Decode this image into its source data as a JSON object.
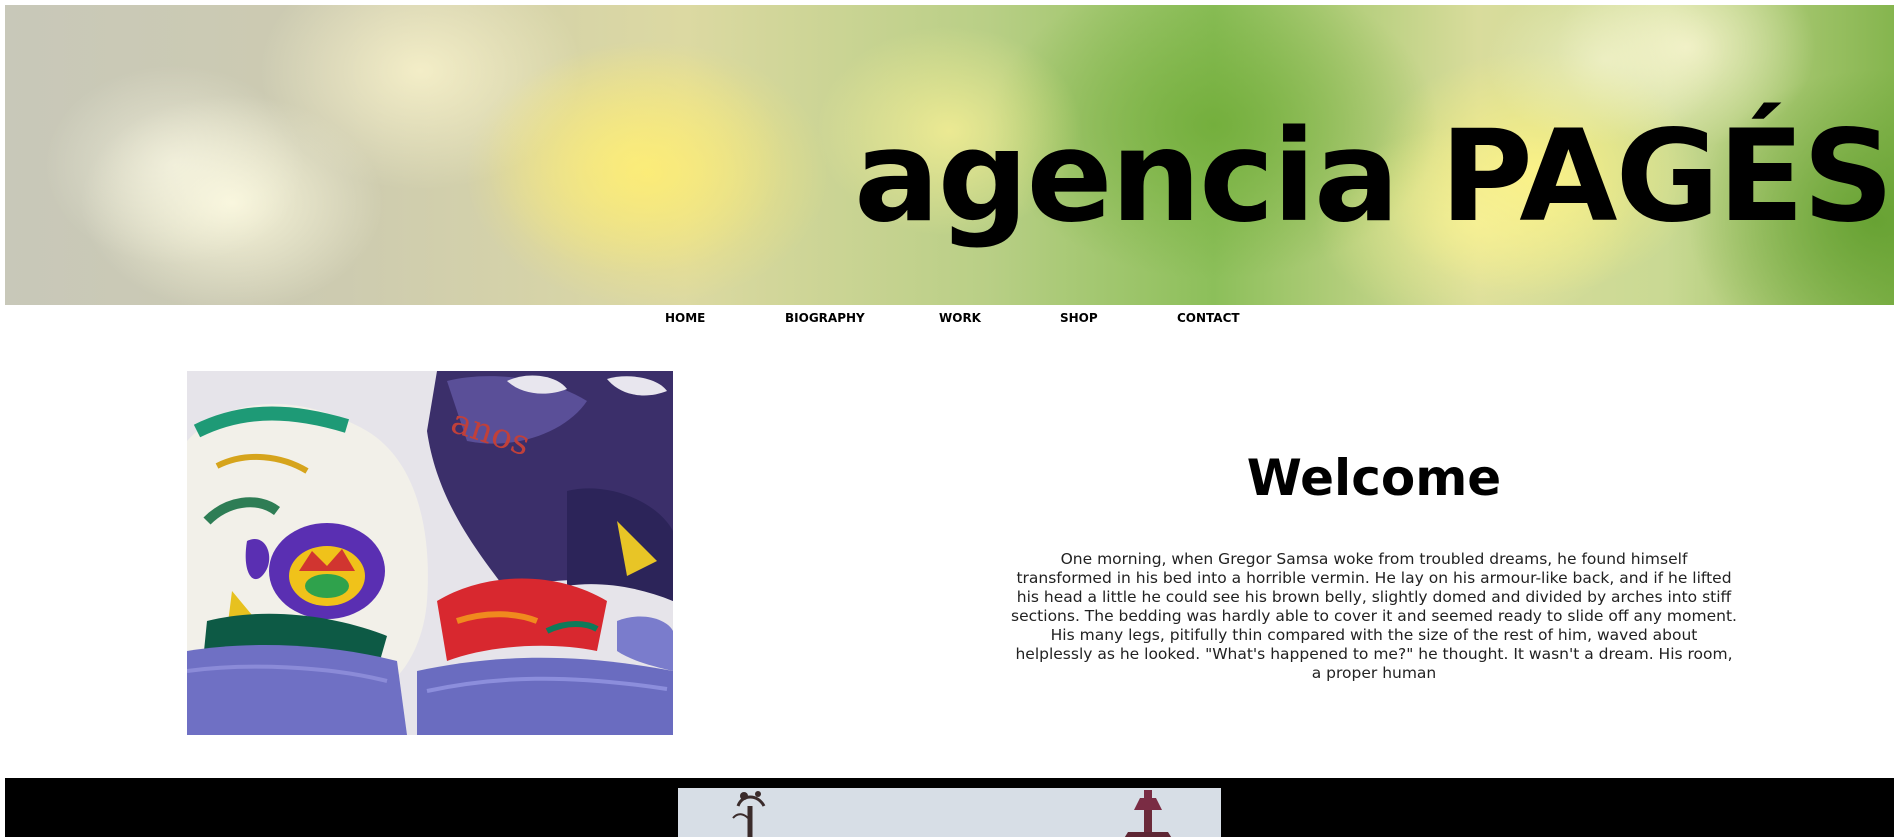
{
  "site": {
    "title": "agencia PAGÉS"
  },
  "nav": {
    "items": [
      {
        "label": "HOME"
      },
      {
        "label": "BIOGRAPHY"
      },
      {
        "label": "WORK"
      },
      {
        "label": "SHOP"
      },
      {
        "label": "CONTACT"
      }
    ]
  },
  "main": {
    "heading": "Welcome",
    "body": "One morning, when Gregor Samsa woke from troubled dreams, he found himself transformed in his bed into a horrible vermin. He lay on his armour-like back, and if he lifted his head a little he could see his brown belly, slightly domed and divided by arches into stiff sections. The bedding was hardly able to cover it and seemed ready to slide off any moment. His many legs, pitifully thin compared with the size of the rest of him, waved about helplessly as he looked. \"What's happened to me?\" he thought. It wasn't a dream. His room, a proper human",
    "image_text": "anos"
  },
  "colors": {
    "text": "#000000",
    "body_text": "#222222",
    "background": "#ffffff",
    "band": "#000000"
  }
}
